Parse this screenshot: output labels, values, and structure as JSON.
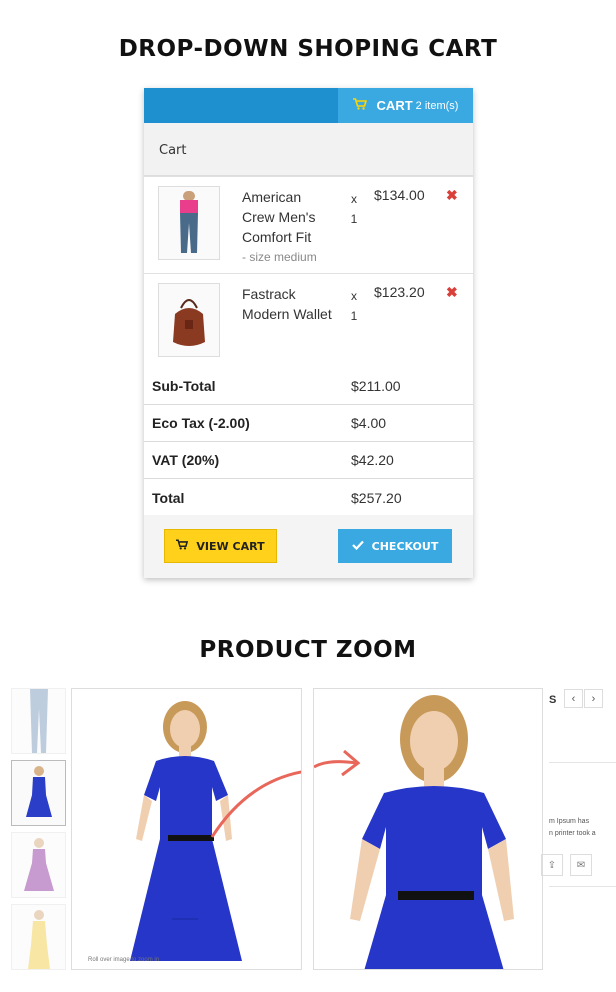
{
  "sections": {
    "cart_heading": "DROP-DOWN SHOPING CART",
    "zoom_heading": "PRODUCT ZOOM"
  },
  "cart": {
    "button_label": "CART",
    "item_count": "2 item(s)",
    "header": "Cart",
    "items": [
      {
        "name": "American Crew Men's Comfort Fit",
        "option": "- size medium",
        "qty_x": "x",
        "qty": "1",
        "price": "$134.00",
        "remove": "✖"
      },
      {
        "name": "Fastrack Modern Wallet",
        "option": "",
        "qty_x": "x",
        "qty": "1",
        "price": "$123.20",
        "remove": "✖"
      }
    ],
    "totals": [
      {
        "label": "Sub-Total",
        "value": "$211.00"
      },
      {
        "label": "Eco Tax (-2.00)",
        "value": "$4.00"
      },
      {
        "label": "VAT (20%)",
        "value": "$42.20"
      },
      {
        "label": "Total",
        "value": "$257.20"
      }
    ],
    "view_cart_label": "VIEW CART",
    "checkout_label": "CHECKOUT",
    "colors": {
      "bar": "#1e90d0",
      "cart_button": "#3aa9e2",
      "view_cart": "#ffd11a",
      "checkout": "#3aa9e2",
      "remove": "#d9403a"
    }
  },
  "zoom": {
    "rollover_text": "Roll over image to zoom in",
    "side_title": "S",
    "prev": "‹",
    "next": "›",
    "side_text_1": "m Ipsum has",
    "side_text_2": "n printer took a",
    "icons": [
      "share-icon",
      "mail-icon"
    ]
  }
}
